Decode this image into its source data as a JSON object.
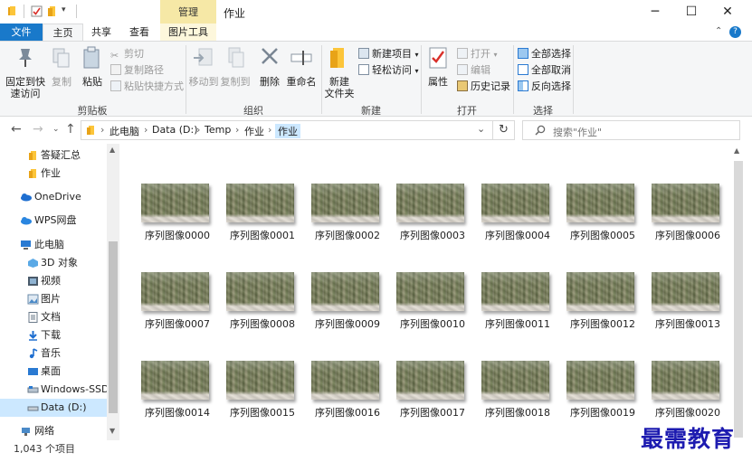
{
  "window": {
    "title": "作业",
    "contextual_tab": "管理"
  },
  "ribbon_tabs": {
    "file": "文件",
    "home": "主页",
    "share": "共享",
    "view": "查看",
    "picture_tools": "图片工具"
  },
  "ribbon": {
    "clipboard": {
      "pin": "固定到快",
      "pin2": "速访问",
      "copy": "复制",
      "paste": "粘贴",
      "cut": "剪切",
      "copy_path": "复制路径",
      "paste_shortcut": "粘贴快捷方式",
      "label": "剪贴板"
    },
    "organize": {
      "move_to": "移动到",
      "copy_to": "复制到",
      "delete": "删除",
      "rename": "重命名",
      "label": "组织"
    },
    "new": {
      "new_folder": "新建",
      "new_folder2": "文件夹",
      "new_item": "新建项目",
      "easy_access": "轻松访问",
      "label": "新建"
    },
    "open": {
      "properties": "属性",
      "open": "打开",
      "edit": "编辑",
      "history": "历史记录",
      "label": "打开"
    },
    "select": {
      "select_all": "全部选择",
      "select_none": "全部取消",
      "invert": "反向选择",
      "label": "选择"
    }
  },
  "address": {
    "crumbs": [
      "此电脑",
      "Data (D:)",
      "Temp",
      "作业",
      "作业"
    ],
    "search_placeholder": "搜索\"作业\""
  },
  "nav": {
    "items": [
      "答疑汇总",
      "作业",
      "OneDrive",
      "WPS网盘",
      "此电脑",
      "3D 对象",
      "视频",
      "图片",
      "文档",
      "下载",
      "音乐",
      "桌面",
      "Windows-SSD (",
      "Data (D:)",
      "网络"
    ]
  },
  "files": [
    "序列图像0000",
    "序列图像0001",
    "序列图像0002",
    "序列图像0003",
    "序列图像0004",
    "序列图像0005",
    "序列图像0006",
    "序列图像0007",
    "序列图像0008",
    "序列图像0009",
    "序列图像0010",
    "序列图像0011",
    "序列图像0012",
    "序列图像0013",
    "序列图像0014",
    "序列图像0015",
    "序列图像0016",
    "序列图像0017",
    "序列图像0018",
    "序列图像0019",
    "序列图像0020"
  ],
  "status": {
    "count": "1,043 个项目"
  },
  "watermark": "最需教育",
  "colors": {
    "file_tab": "#1979ca",
    "manage_tab": "#f6e8a6",
    "selection": "#cce8ff",
    "watermark": "#1d1bb0"
  }
}
